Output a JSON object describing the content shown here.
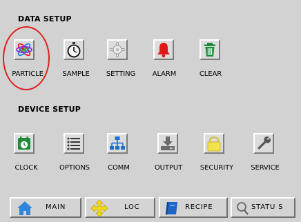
{
  "data_setup": {
    "title": "DATA SETUP",
    "items": [
      {
        "label": "PARTICLE",
        "icon": "atom-icon",
        "selected": true
      },
      {
        "label": "SAMPLE",
        "icon": "stopwatch-icon"
      },
      {
        "label": "SETTING",
        "icon": "gear-icon"
      },
      {
        "label": "ALARM",
        "icon": "bell-icon"
      },
      {
        "label": "CLEAR",
        "icon": "trash-icon"
      }
    ]
  },
  "device_setup": {
    "title": "DEVICE SETUP",
    "items": [
      {
        "label": "CLOCK",
        "icon": "calendar-clock-icon"
      },
      {
        "label": "OPTIONS",
        "icon": "list-icon"
      },
      {
        "label": "COMM",
        "icon": "network-icon"
      },
      {
        "label": "OUTPUT",
        "icon": "download-icon"
      },
      {
        "label": "SECURITY",
        "icon": "lock-icon"
      },
      {
        "label": "SERVICE",
        "icon": "wrench-icon"
      }
    ]
  },
  "nav": [
    {
      "label": "MAIN",
      "icon": "home-icon"
    },
    {
      "label": "LOC",
      "icon": "move-arrows-icon"
    },
    {
      "label": "RECIPE",
      "icon": "book-icon"
    },
    {
      "label": "STATU S",
      "icon": "magnifier-icon"
    }
  ],
  "colors": {
    "background": "#d2d2d2",
    "highlight_ring": "#e0201c",
    "icon_green": "#1f8a3a",
    "icon_blue": "#1e6fd0",
    "icon_red": "#e01818",
    "icon_yellow": "#f3e14a"
  }
}
